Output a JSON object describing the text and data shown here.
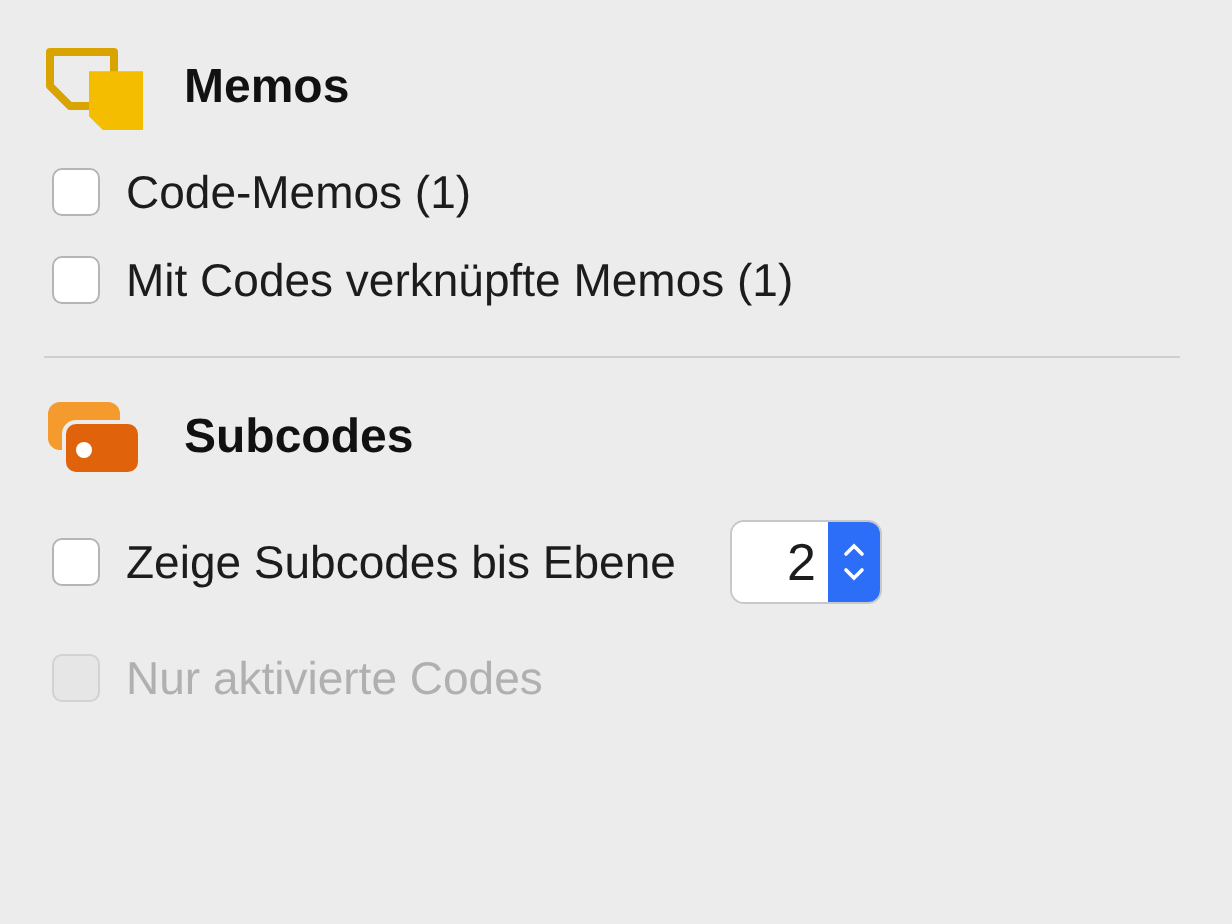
{
  "sections": [
    {
      "kind": "memos",
      "title": "Memos",
      "options": [
        {
          "label": "Code-Memos (1)",
          "checked": false,
          "disabled": false
        },
        {
          "label": "Mit Codes verknüpfte Memos (1)",
          "checked": false,
          "disabled": false
        }
      ]
    },
    {
      "kind": "subcodes",
      "title": "Subcodes",
      "options": [
        {
          "label": "Zeige Subcodes bis Ebene",
          "checked": false,
          "disabled": false,
          "stepper_value": "2"
        },
        {
          "label": "Nur aktivierte Codes",
          "checked": false,
          "disabled": true
        }
      ]
    }
  ]
}
